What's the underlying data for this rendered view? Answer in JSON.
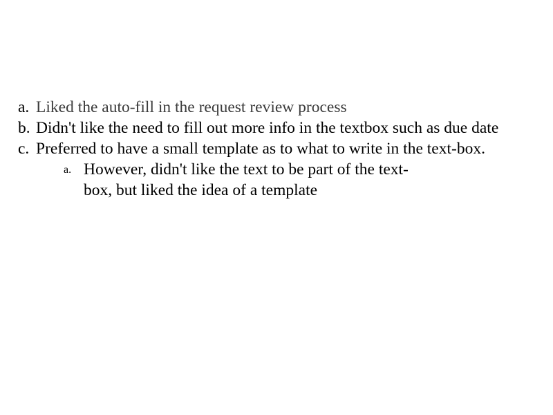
{
  "slide": {
    "background_color": "#ffffff",
    "body_text_color": "#000000",
    "muted_text_color": "#3c3c3c",
    "list": [
      {
        "marker": "a.",
        "text": "Liked the auto-fill in the request review process",
        "muted": true
      },
      {
        "marker": "b.",
        "text": "Didn't like the need to fill out more info in the textbox such as due date",
        "muted": false
      },
      {
        "marker": "c.",
        "text": "Preferred to have a small template as to what to write in the text-box.",
        "muted": false,
        "sublist": [
          {
            "marker": "a.",
            "text": "However, didn't like the text to be part of the text-box, but liked the idea of a template"
          }
        ]
      }
    ]
  }
}
